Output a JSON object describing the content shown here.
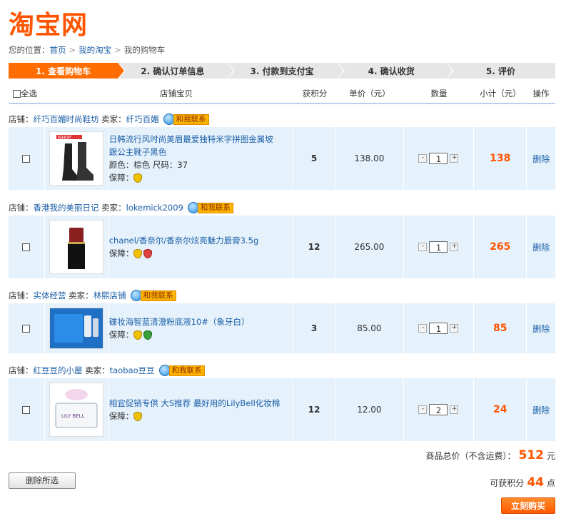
{
  "logo": "淘宝网",
  "breadcrumb": {
    "prefix": "您的位置：",
    "items": [
      "首页",
      "我的淘宝",
      "我的购物车"
    ]
  },
  "steps": [
    "1. 查看购物车",
    "2. 确认订单信息",
    "3. 付款到支付宝",
    "4. 确认收货",
    "5. 评价"
  ],
  "table_header": {
    "select_all": "全选",
    "item": "店铺宝贝",
    "points": "获积分",
    "price": "单价（元）",
    "qty": "数量",
    "subtotal": "小计（元）",
    "op": "操作"
  },
  "labels": {
    "shop": "店铺：",
    "seller": "卖家：",
    "contact": "和我联系",
    "guarantee": "保障：",
    "delete": "删除",
    "minus": "-",
    "plus": "+"
  },
  "shops": [
    {
      "shop_name": "纤巧百媚时尚鞋坊",
      "seller": "纤巧百媚",
      "item": {
        "title_lines": [
          "日韩流行风时尚美眉最爱独特米字拼图金属坡",
          "跟公主靴子黑色"
        ],
        "attrs": "颜色：棕色 尺码：37",
        "thumb_text": "JSHOP",
        "points": "5",
        "price": "138.00",
        "qty": "1",
        "subtotal": "138",
        "guarantees": [
          "yellow"
        ]
      }
    },
    {
      "shop_name": "香港我的美丽日记",
      "seller": "lokemick2009",
      "item": {
        "title_lines": [
          "chanel/香奈尔/香奈尔炫亮魅力唇膏3.5g"
        ],
        "attrs": "",
        "thumb_text": "",
        "points": "12",
        "price": "265.00",
        "qty": "1",
        "subtotal": "265",
        "guarantees": [
          "yellow",
          "red"
        ]
      }
    },
    {
      "shop_name": "实体经营",
      "seller": "林熙店铺",
      "item": {
        "title_lines": [
          "碟妆海智蓝清澄粉底液10#（象牙白）"
        ],
        "attrs": "",
        "thumb_text": "",
        "points": "3",
        "price": "85.00",
        "qty": "1",
        "subtotal": "85",
        "guarantees": [
          "yellow",
          "green"
        ]
      }
    },
    {
      "shop_name": "红豆豆的小屋",
      "seller": "taobao豆豆",
      "item": {
        "title_lines": [
          "相宜促销专供 大S推荐 最好用的LilyBell化妆棉"
        ],
        "attrs": "",
        "thumb_text": "LILY BELL",
        "points": "12",
        "price": "12.00",
        "qty": "2",
        "subtotal": "24",
        "guarantees": [
          "yellow"
        ]
      }
    }
  ],
  "summary": {
    "total_label": "商品总价（不含运费）：",
    "total": "512",
    "total_unit": "元",
    "points_label": "可获积分",
    "points": "44",
    "points_unit": "点"
  },
  "buttons": {
    "delete_selected": "删除所选",
    "buy_now": "立刻购买"
  }
}
